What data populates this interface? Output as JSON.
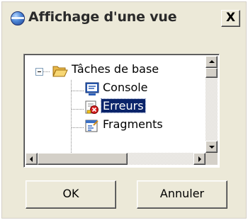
{
  "window": {
    "title": "Affichage d'une vue",
    "close_label": "X"
  },
  "tree": {
    "root": {
      "label": "Tâches de base",
      "expanded": true,
      "icon": "folder-open-icon"
    },
    "children": [
      {
        "label": "Console",
        "icon": "console-icon",
        "selected": false
      },
      {
        "label": "Erreurs",
        "icon": "errors-icon",
        "selected": true
      },
      {
        "label": "Fragments",
        "icon": "fragments-icon",
        "selected": false
      }
    ]
  },
  "buttons": {
    "ok": "OK",
    "cancel": "Annuler"
  },
  "colors": {
    "dialog_bg": "#ece9d8",
    "selection_bg": "#0a246a",
    "selection_fg": "#ffffff"
  }
}
